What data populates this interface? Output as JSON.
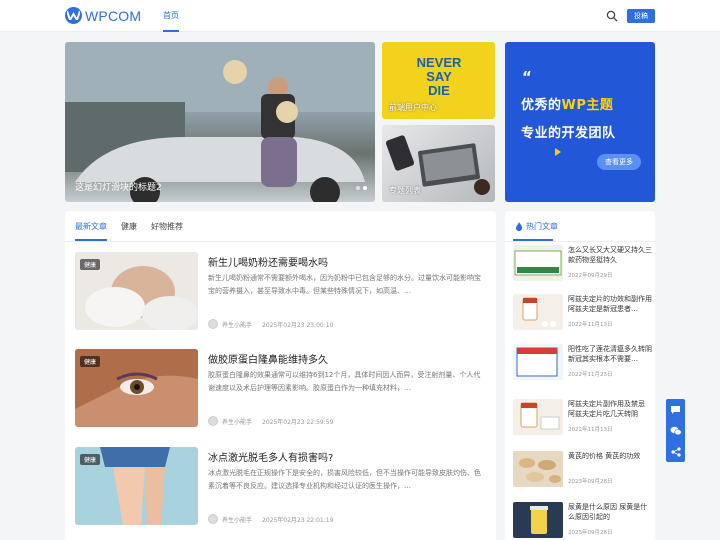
{
  "header": {
    "logo": "WPCOM",
    "nav_home": "首页",
    "post_button": "投稿"
  },
  "slider": {
    "caption": "这是幻灯滑块的标题2"
  },
  "tiles": [
    {
      "label": "前端用户中心",
      "poster_text": "NEVER SAY DIE"
    },
    {
      "label": "专题列表"
    }
  ],
  "promo": {
    "quote": "“",
    "line1_prefix": "优秀的",
    "line1_highlight": "WP主题",
    "line2": "专业的开发团队",
    "button": "查看更多"
  },
  "tabs": [
    "最新文章",
    "健康",
    "好物推荐"
  ],
  "posts": [
    {
      "badge": "健康",
      "title": "新生儿喝奶粉还需要喝水吗",
      "excerpt": "新生儿喝奶粉通常不需要额外喝水，因为奶粉中已包含足够的水分。过量饮水可能影响宝宝的营养摄入，甚至导致水中毒。但某些特殊情况下，如高温、…",
      "author": "养生小能手",
      "date": "2025年02月23 23:00:10"
    },
    {
      "badge": "健康",
      "title": "做胶原蛋白隆鼻能维持多久",
      "excerpt": "胶原蛋白隆鼻的效果通常可以维持6到12个月，具体时间因人而异，受注射剂量、个人代谢速度以及术后护理等因素影响。胶原蛋白作为一种填充材料，…",
      "author": "养生小能手",
      "date": "2025年02月23 22:59:59"
    },
    {
      "badge": "健康",
      "title": "冰点激光脱毛多人有损害吗?",
      "excerpt": "冰点激光脱毛在正规操作下是安全的，损害风险较低，但不当操作可能导致皮肤灼伤、色素沉着等不良反应。建议选择专业机构和经过认证的医生操作，…",
      "author": "养生小能手",
      "date": "2025年02月23 22:01:19"
    }
  ],
  "sidebar": {
    "title": "热门文章",
    "items": [
      {
        "title": "怎么又长又大又硬又持久三款药物坚挺持久",
        "date": "2022年09月29日"
      },
      {
        "title": "阿兹夫定片的功效和副作用 阿兹夫定是新冠患者…",
        "date": "2022年11月13日"
      },
      {
        "title": "阳性吃了莲花清瘟多久转阴 新冠其实根本不需要…",
        "date": "2022年11月23日"
      },
      {
        "title": "阿兹夫定片副作用及禁忌 阿兹夫定片吃几天转阴",
        "date": "2022年11月13日"
      },
      {
        "title": "黄芪的价格 黄芪的功效",
        "date": "2023年09月28日"
      },
      {
        "title": "尿黄是什么原因 尿黄是什么原因引起的",
        "date": "2023年09月28日"
      }
    ]
  },
  "colors": {
    "accent": "#2f6fe0",
    "promo_bg": "#2257d8",
    "highlight": "#ffd400"
  }
}
